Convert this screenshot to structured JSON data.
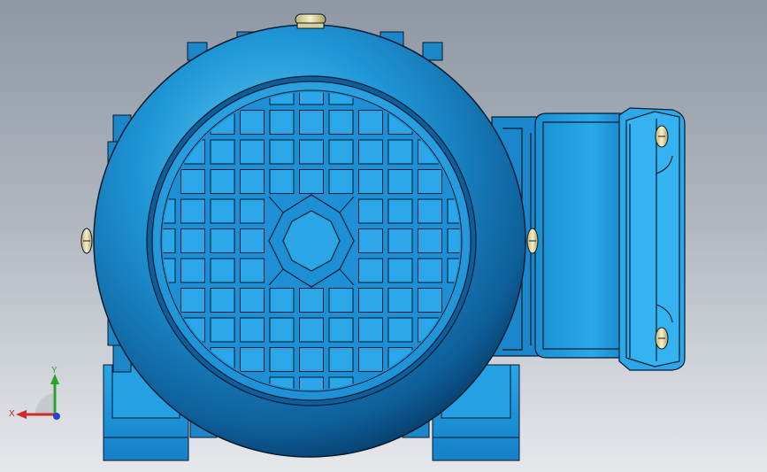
{
  "viewport": {
    "background_top": "#8e97a3",
    "background_bottom": "#e6e8eb"
  },
  "model": {
    "body_color": "#1e8fd0",
    "body_highlight": "#4fc2f0",
    "edge_color": "#0a1a2a",
    "bolt_color": "#e8dfa6"
  },
  "triad": {
    "x_label": "X",
    "y_label": "Y",
    "x_color": "#d22828",
    "y_color": "#2aa52a",
    "z_color": "#2a3fd0"
  }
}
